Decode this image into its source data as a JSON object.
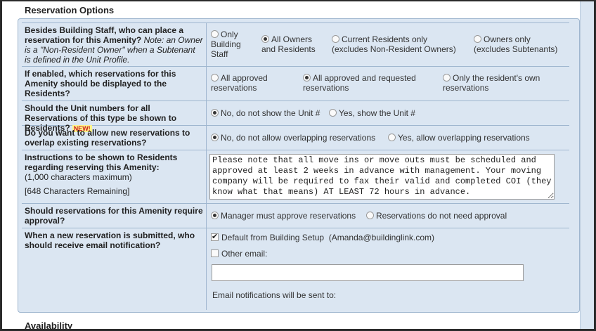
{
  "section_title": "Reservation Options",
  "availability_title": "Availability",
  "q1": {
    "bold": "Besides Building Staff, who can place a reservation for this Amenity?",
    "note": "Note: an Owner is a \"Non-Resident Owner\" when a Subtenant is defined in the Unit Profile.",
    "options": [
      "Only Building Staff",
      "All Owners and Residents",
      "Current Residents only (excludes Non-Resident Owners)",
      "Owners only (excludes Subtenants)"
    ],
    "selected": 1
  },
  "q2": {
    "bold": "If enabled, which reservations for this Amenity should be displayed to the Residents?",
    "options": [
      "All approved reservations",
      "All approved and requested reservations",
      "Only the resident's own reservations"
    ],
    "selected": 1
  },
  "q3": {
    "bold": "Should the Unit numbers for all Reservations of this type be shown to Residents?",
    "badge": "NEW!",
    "options": [
      "No, do not show the Unit #",
      "Yes, show the Unit #"
    ],
    "selected": 0
  },
  "q4": {
    "bold": "Do you want to allow new reservations to overlap existing reservations?",
    "options": [
      "No, do not allow overlapping reservations",
      "Yes, allow overlapping reservations"
    ],
    "selected": 0
  },
  "q5": {
    "bold": "Instructions to be shown to Residents regarding reserving this Amenity:",
    "limit": "(1,000 characters maximum)",
    "remaining": "[648 Characters Remaining]",
    "value": "Please note that all move ins or move outs must be scheduled and approved at least 2 weeks in advance with management. Your moving company will be required to fax their valid and completed COI (they know what that means) AT LEAST 72 hours in advance."
  },
  "q6": {
    "bold": "Should reservations for this Amenity require approval?",
    "options": [
      "Manager must approve reservations",
      "Reservations do not need approval"
    ],
    "selected": 0
  },
  "q7": {
    "bold": "When a new reservation is submitted, who should receive email notification?",
    "default_label": "Default from Building Setup",
    "default_email": "(Amanda@buildinglink.com)",
    "other_label": "Other email:",
    "other_value": "",
    "notify_text": "Email notifications will be sent to:"
  }
}
